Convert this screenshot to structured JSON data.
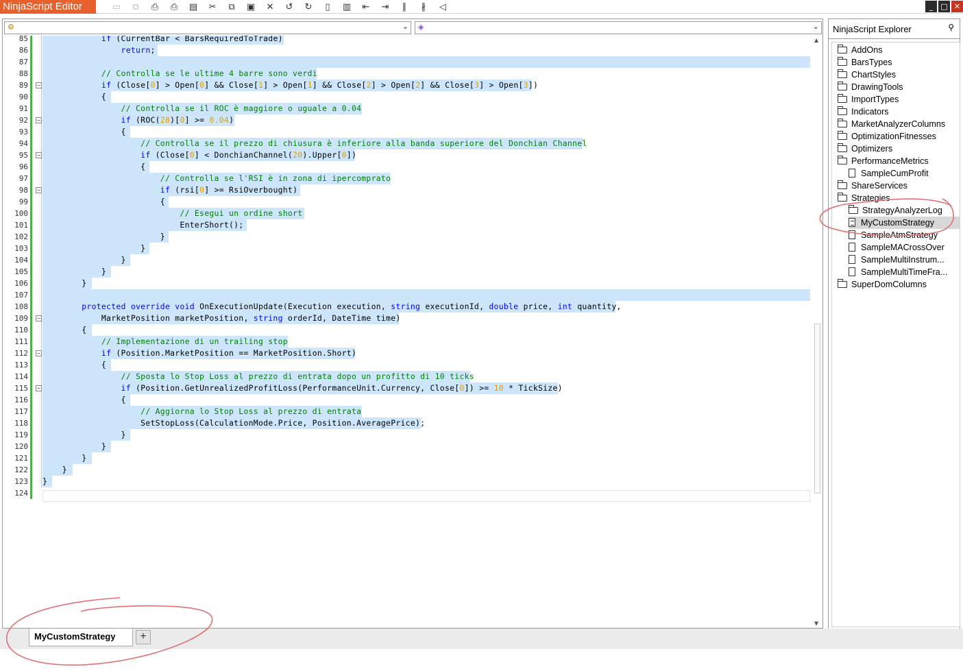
{
  "app": {
    "title": "NinjaScript Editor"
  },
  "toolbar": {
    "icons": [
      "save-icon",
      "save-all-icon",
      "print-icon",
      "print-preview-icon",
      "properties-icon",
      "cut-icon",
      "copy-icon",
      "paste-icon",
      "delete-icon",
      "undo-icon",
      "redo-icon",
      "find-icon",
      "compile-icon",
      "outdent-icon",
      "indent-icon",
      "comment-icon",
      "uncomment-icon",
      "visual-studio-icon"
    ]
  },
  "editor": {
    "class_dropdown": "",
    "member_dropdown": "",
    "lines": [
      {
        "n": "85",
        "code": "            <span class=\"kw\">if</span> (CurrentBar &lt; BarsRequiredToTrade)",
        "w": 352,
        "fold": false
      },
      {
        "n": "86",
        "code": "                <span class=\"kw\">return</span>;",
        "w": 168,
        "fold": false
      },
      {
        "n": "87",
        "code": "",
        "w": 1120,
        "fold": false
      },
      {
        "n": "88",
        "code": "            <span class=\"cm\">// Controlla se le ultime 4 barre sono verdi</span>",
        "w": 400,
        "fold": false
      },
      {
        "n": "89",
        "code": "            <span class=\"kw\">if</span> (Close[<span class=\"num\">0</span>] &gt; Open[<span class=\"num\">0</span>] &amp;&amp; Close[<span class=\"num\">1</span>] &gt; Open[<span class=\"num\">1</span>] &amp;&amp; Close[<span class=\"num\">2</span>] &gt; Open[<span class=\"num\">2</span>] &amp;&amp; Close[<span class=\"num\">3</span>] &gt; Open[<span class=\"num\">3</span>])",
        "w": 713,
        "fold": true
      },
      {
        "n": "90",
        "code": "            {",
        "w": 100,
        "fold": false
      },
      {
        "n": "91",
        "code": "                <span class=\"cm\">// Controlla se il ROC è maggiore o uguale a 0.04</span>",
        "w": 466,
        "fold": false
      },
      {
        "n": "92",
        "code": "                <span class=\"kw\">if</span> (ROC(<span class=\"num\">28</span>)[<span class=\"num\">0</span>] &gt;= <span class=\"num\">0.04</span>)",
        "w": 280,
        "fold": true
      },
      {
        "n": "93",
        "code": "                {",
        "w": 128,
        "fold": false
      },
      {
        "n": "94",
        "code": "                    <span class=\"cm\">// Controlla se il prezzo di chiusura è inferiore alla banda superiore del Donchian Channel</span>",
        "w": 788,
        "fold": false
      },
      {
        "n": "95",
        "code": "                    <span class=\"kw\">if</span> (Close[<span class=\"num\">0</span>] &lt; DonchianChannel(<span class=\"num\">20</span>).Upper[<span class=\"num\">0</span>])",
        "w": 456,
        "fold": true
      },
      {
        "n": "96",
        "code": "                    {",
        "w": 156,
        "fold": false
      },
      {
        "n": "97",
        "code": "                        <span class=\"cm\">// Controlla se l'RSI è in zona di ipercomprato</span>",
        "w": 508,
        "fold": false
      },
      {
        "n": "98",
        "code": "                        <span class=\"kw\">if</span> (rsi[<span class=\"num\">0</span>] &gt;= RsiOverbought)",
        "w": 376,
        "fold": true
      },
      {
        "n": "99",
        "code": "                        {",
        "w": 184,
        "fold": false
      },
      {
        "n": "100",
        "code": "                            <span class=\"cm\">// Esegui un ordine short</span>",
        "w": 382,
        "fold": false
      },
      {
        "n": "101",
        "code": "                            EnterShort();",
        "w": 298,
        "fold": false
      },
      {
        "n": "102",
        "code": "                        }",
        "w": 184,
        "fold": false
      },
      {
        "n": "103",
        "code": "                    }",
        "w": 156,
        "fold": false
      },
      {
        "n": "104",
        "code": "                }",
        "w": 128,
        "fold": false
      },
      {
        "n": "105",
        "code": "            }",
        "w": 100,
        "fold": false
      },
      {
        "n": "106",
        "code": "        }",
        "w": 72,
        "fold": false
      },
      {
        "n": "107",
        "code": "",
        "w": 1120,
        "fold": false
      },
      {
        "n": "108",
        "code": "        <span class=\"kw\">protected override void</span> OnExecutionUpdate(Execution execution, <span class=\"kw\">string</span> executionId, <span class=\"kw\">double</span> price, <span class=\"kw\">int</span> quantity,",
        "w": 836,
        "fold": false
      },
      {
        "n": "109",
        "code": "            MarketPosition marketPosition, <span class=\"kw\">string</span> orderId, DateTime time)",
        "w": 520,
        "fold": true
      },
      {
        "n": "110",
        "code": "        {",
        "w": 72,
        "fold": false
      },
      {
        "n": "111",
        "code": "            <span class=\"cm\">// Implementazione di un trailing stop</span>",
        "w": 358,
        "fold": false
      },
      {
        "n": "112",
        "code": "            <span class=\"kw\">if</span> (Position.MarketPosition == MarketPosition.Short)",
        "w": 456,
        "fold": true
      },
      {
        "n": "113",
        "code": "            {",
        "w": 100,
        "fold": false
      },
      {
        "n": "114",
        "code": "                <span class=\"cm\">// Sposta lo Stop Loss al prezzo di entrata dopo un profitto di 10 ticks</span>",
        "w": 624,
        "fold": false
      },
      {
        "n": "115",
        "code": "                <span class=\"kw\">if</span> (Position.GetUnrealizedProfitLoss(PerformanceUnit.Currency, Close[<span class=\"num\">0</span>]) &gt;= <span class=\"num\">10</span> * TickSize)",
        "w": 752,
        "fold": true
      },
      {
        "n": "116",
        "code": "                {",
        "w": 128,
        "fold": false
      },
      {
        "n": "117",
        "code": "                    <span class=\"cm\">// Aggiorna lo Stop Loss al prezzo di entrata</span>",
        "w": 466,
        "fold": false
      },
      {
        "n": "118",
        "code": "                    SetStopLoss(CalculationMode.Price, Position.AveragePrice);",
        "w": 552,
        "fold": false
      },
      {
        "n": "119",
        "code": "                }",
        "w": 128,
        "fold": false
      },
      {
        "n": "120",
        "code": "            }",
        "w": 100,
        "fold": false
      },
      {
        "n": "121",
        "code": "        }",
        "w": 72,
        "fold": false
      },
      {
        "n": "122",
        "code": "    }",
        "w": 44,
        "fold": false
      },
      {
        "n": "123",
        "code": "}",
        "w": 14,
        "fold": false
      },
      {
        "n": "124",
        "code": "",
        "w": 0,
        "fold": false
      }
    ]
  },
  "explorer": {
    "title": "NinjaScript Explorer",
    "tree": [
      {
        "label": "AddOns",
        "type": "folder",
        "level": 0
      },
      {
        "label": "BarsTypes",
        "type": "folder",
        "level": 0
      },
      {
        "label": "ChartStyles",
        "type": "folder",
        "level": 0
      },
      {
        "label": "DrawingTools",
        "type": "folder",
        "level": 0
      },
      {
        "label": "ImportTypes",
        "type": "folder",
        "level": 0
      },
      {
        "label": "Indicators",
        "type": "folder",
        "level": 0
      },
      {
        "label": "MarketAnalyzerColumns",
        "type": "folder",
        "level": 0
      },
      {
        "label": "OptimizationFitnesses",
        "type": "folder",
        "level": 0
      },
      {
        "label": "Optimizers",
        "type": "folder",
        "level": 0
      },
      {
        "label": "PerformanceMetrics",
        "type": "folder",
        "level": 0
      },
      {
        "label": "SampleCumProfit",
        "type": "file",
        "level": 1
      },
      {
        "label": "ShareServices",
        "type": "folder",
        "level": 0
      },
      {
        "label": "Strategies",
        "type": "folder",
        "level": 0
      },
      {
        "label": "StrategyAnalyzerLog",
        "type": "folder",
        "level": 1
      },
      {
        "label": "MyCustomStrategy",
        "type": "file-lined",
        "level": 1,
        "selected": true
      },
      {
        "label": "SampleAtmStrategy",
        "type": "file",
        "level": 1
      },
      {
        "label": "SampleMACrossOver",
        "type": "file",
        "level": 1
      },
      {
        "label": "SampleMultiInstrum...",
        "type": "file",
        "level": 1
      },
      {
        "label": "SampleMultiTimeFra...",
        "type": "file",
        "level": 1
      },
      {
        "label": "SuperDomColumns",
        "type": "folder",
        "level": 0
      }
    ]
  },
  "tabs": {
    "active": "MyCustomStrategy",
    "add": "+"
  },
  "colors": {
    "brand": "#e8602c",
    "selection": "#cde6fb",
    "keyword": "#0000ff",
    "comment": "#008000",
    "number": "#e0a000",
    "annotation": "#e07070"
  }
}
